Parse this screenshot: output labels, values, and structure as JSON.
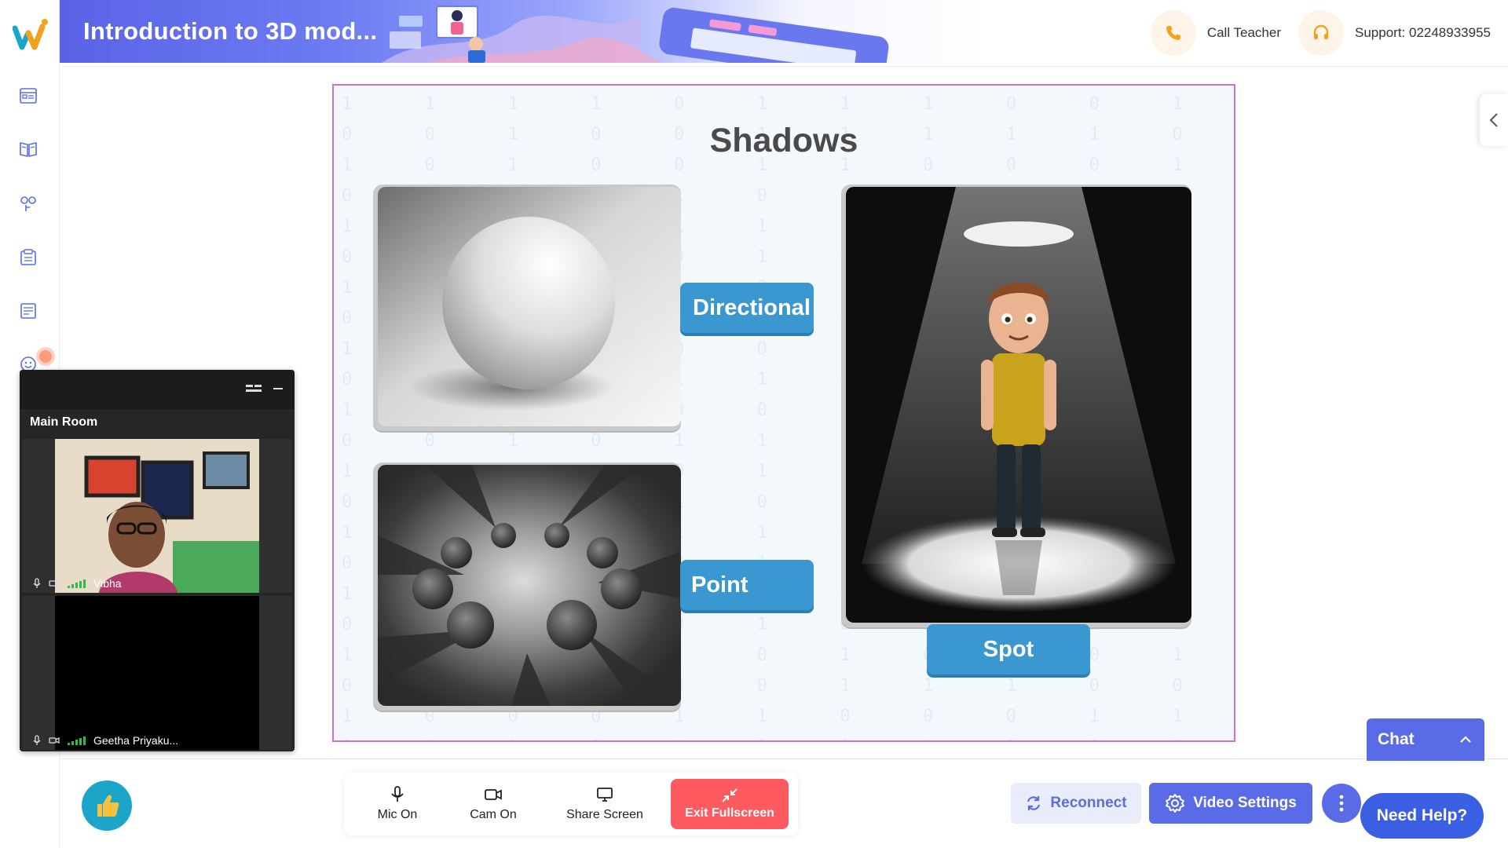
{
  "header": {
    "title": "Introduction to 3D mod...",
    "call_teacher_label": "Call Teacher",
    "support_label": "Support: 02248933955"
  },
  "sidebar": {
    "items": [
      {
        "icon": "class-schedule-icon"
      },
      {
        "icon": "book-icon"
      },
      {
        "icon": "activity-icon"
      },
      {
        "icon": "notes-icon"
      },
      {
        "icon": "worksheet-icon"
      },
      {
        "icon": "emoji-icon"
      }
    ]
  },
  "slide": {
    "title": "Shadows",
    "labels": {
      "directional": "Directional",
      "point": "Point",
      "spot": "Spot"
    }
  },
  "video_panel": {
    "room_label": "Main Room",
    "participants": [
      {
        "name": "Vibha"
      },
      {
        "name": "Geetha Priyaku..."
      }
    ]
  },
  "controls": {
    "mic_label": "Mic On",
    "cam_label": "Cam On",
    "share_label": "Share Screen",
    "exit_label": "Exit Fullscreen"
  },
  "actions": {
    "reconnect_label": "Reconnect",
    "video_settings_label": "Video Settings",
    "need_help_label": "Need Help?",
    "chat_label": "Chat"
  },
  "colors": {
    "accent": "#5a6be7",
    "exit_red": "#ff5a5f",
    "label_blue": "#3b97cf",
    "slide_border": "#cf6fd0"
  }
}
